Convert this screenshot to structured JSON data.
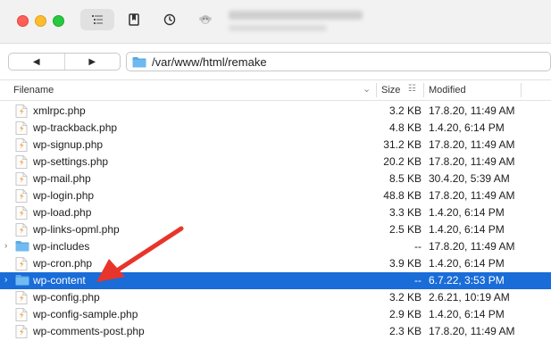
{
  "window": {
    "server_info_blurred": true
  },
  "toolbar": {
    "outline_icon": "outline-icon",
    "bookmark_icon": "bookmark-icon",
    "history_icon": "history-icon",
    "transcript_icon": "monkey-icon"
  },
  "nav": {
    "back_label": "◀",
    "forward_label": "▶",
    "path": "/var/www/html/remake"
  },
  "columns": {
    "filename": "Filename",
    "size": "Size",
    "modified": "Modified"
  },
  "files": [
    {
      "name": "xmlrpc.php",
      "size": "3.2 KB",
      "modified": "17.8.20, 11:49 AM",
      "type": "php",
      "selected": false
    },
    {
      "name": "wp-trackback.php",
      "size": "4.8 KB",
      "modified": "1.4.20, 6:14 PM",
      "type": "php",
      "selected": false
    },
    {
      "name": "wp-signup.php",
      "size": "31.2 KB",
      "modified": "17.8.20, 11:49 AM",
      "type": "php",
      "selected": false
    },
    {
      "name": "wp-settings.php",
      "size": "20.2 KB",
      "modified": "17.8.20, 11:49 AM",
      "type": "php",
      "selected": false
    },
    {
      "name": "wp-mail.php",
      "size": "8.5 KB",
      "modified": "30.4.20, 5:39 AM",
      "type": "php",
      "selected": false
    },
    {
      "name": "wp-login.php",
      "size": "48.8 KB",
      "modified": "17.8.20, 11:49 AM",
      "type": "php",
      "selected": false
    },
    {
      "name": "wp-load.php",
      "size": "3.3 KB",
      "modified": "1.4.20, 6:14 PM",
      "type": "php",
      "selected": false
    },
    {
      "name": "wp-links-opml.php",
      "size": "2.5 KB",
      "modified": "1.4.20, 6:14 PM",
      "type": "php",
      "selected": false
    },
    {
      "name": "wp-includes",
      "size": "--",
      "modified": "17.8.20, 11:49 AM",
      "type": "folder",
      "selected": false
    },
    {
      "name": "wp-cron.php",
      "size": "3.9 KB",
      "modified": "1.4.20, 6:14 PM",
      "type": "php",
      "selected": false
    },
    {
      "name": "wp-content",
      "size": "--",
      "modified": "6.7.22, 3:53 PM",
      "type": "folder",
      "selected": true
    },
    {
      "name": "wp-config.php",
      "size": "3.2 KB",
      "modified": "2.6.21, 10:19 AM",
      "type": "php",
      "selected": false
    },
    {
      "name": "wp-config-sample.php",
      "size": "2.9 KB",
      "modified": "1.4.20, 6:14 PM",
      "type": "php",
      "selected": false
    },
    {
      "name": "wp-comments-post.php",
      "size": "2.3 KB",
      "modified": "17.8.20, 11:49 AM",
      "type": "php",
      "selected": false
    }
  ],
  "colors": {
    "selection": "#1a6cd8",
    "folder": "#5aa9e8",
    "php_icon": "#e8a33a",
    "annotation_arrow": "#e8352b"
  }
}
